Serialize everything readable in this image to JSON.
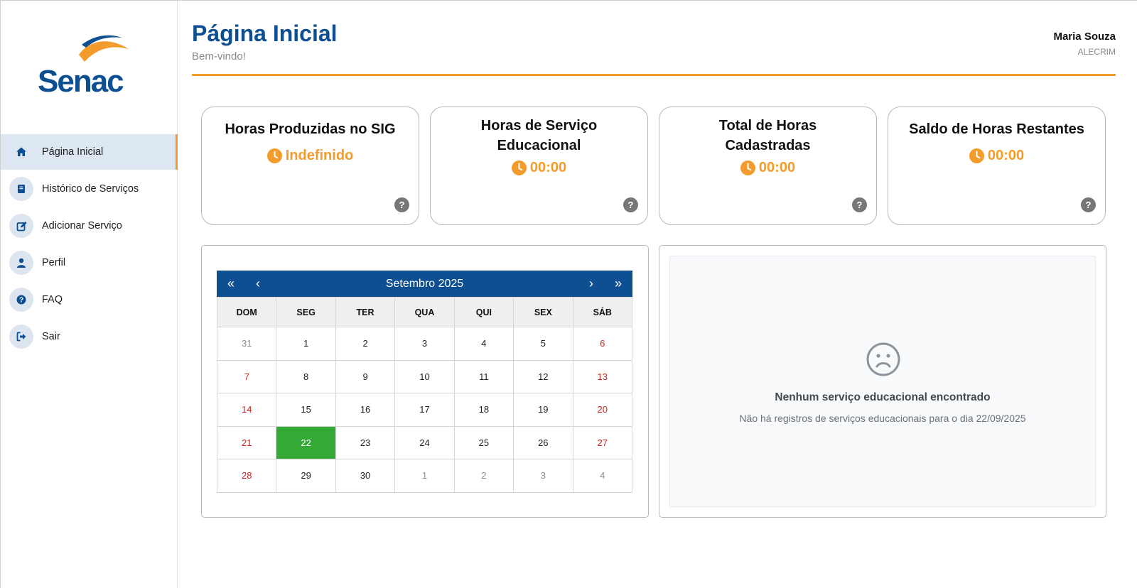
{
  "brand": {
    "logo_text": "Senac",
    "primary_color": "#0d4f91",
    "accent_color": "#f39c2b"
  },
  "sidebar": {
    "items": [
      {
        "label": "Página Inicial",
        "icon": "home-icon",
        "active": true
      },
      {
        "label": "Histórico de Serviços",
        "icon": "book-icon",
        "active": false
      },
      {
        "label": "Adicionar Serviço",
        "icon": "edit-icon",
        "active": false
      },
      {
        "label": "Perfil",
        "icon": "user-icon",
        "active": false
      },
      {
        "label": "FAQ",
        "icon": "question-icon",
        "active": false
      },
      {
        "label": "Sair",
        "icon": "logout-icon",
        "active": false
      }
    ]
  },
  "header": {
    "title": "Página Inicial",
    "subtitle": "Bem-vindo!",
    "user_name": "Maria Souza",
    "user_unit": "ALECRIM"
  },
  "cards": [
    {
      "title": "Horas Produzidas no SIG",
      "value": "Indefinido"
    },
    {
      "title": "Horas de Serviço Educacional",
      "value": "00:00"
    },
    {
      "title": "Total de Horas Cadastradas",
      "value": "00:00"
    },
    {
      "title": "Saldo de Horas Restantes",
      "value": "00:00"
    }
  ],
  "calendar": {
    "prev_year": "«",
    "prev_month": "‹",
    "next_month": "›",
    "next_year": "»",
    "month_label": "Setembro 2025",
    "weekdays": [
      "DOM",
      "SEG",
      "TER",
      "QUA",
      "QUI",
      "SEX",
      "SÁB"
    ],
    "weeks": [
      [
        "31",
        "1",
        "2",
        "3",
        "4",
        "5",
        "6"
      ],
      [
        "7",
        "8",
        "9",
        "10",
        "11",
        "12",
        "13"
      ],
      [
        "14",
        "15",
        "16",
        "17",
        "18",
        "19",
        "20"
      ],
      [
        "21",
        "22",
        "23",
        "24",
        "25",
        "26",
        "27"
      ],
      [
        "28",
        "29",
        "30",
        "1",
        "2",
        "3",
        "4"
      ]
    ],
    "selected_day": "22",
    "selected_color": "#34a935",
    "weekend_color": "#cc2222"
  },
  "empty_state": {
    "icon": "sad-face-icon",
    "title": "Nenhum serviço educacional encontrado",
    "text": "Não há registros de serviços educacionais para o dia 22/09/2025"
  }
}
